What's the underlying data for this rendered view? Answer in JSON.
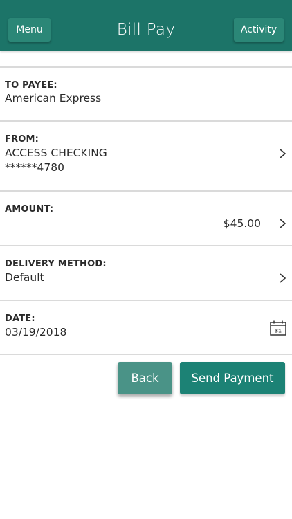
{
  "header": {
    "menu_label": "Menu",
    "title": "Bill Pay",
    "activity_label": "Activity"
  },
  "form": {
    "payee": {
      "label": "TO PAYEE:",
      "value": "American Express"
    },
    "from": {
      "label": "FROM:",
      "account_name": "ACCESS CHECKING",
      "account_number": "******4780"
    },
    "amount": {
      "label": "AMOUNT:",
      "value": "$45.00"
    },
    "delivery": {
      "label": "DELIVERY METHOD:",
      "value": "Default"
    },
    "date": {
      "label": "DATE:",
      "value": "03/19/2018",
      "calendar_day": "31"
    }
  },
  "actions": {
    "back_label": "Back",
    "send_label": "Send Payment"
  },
  "icons": {
    "chevron": "chevron-right-icon",
    "calendar": "calendar-icon"
  },
  "colors": {
    "header_bg": "#1c7468",
    "header_button": "#2b8777",
    "primary_button": "#1c8275",
    "back_button": "#4a9387",
    "divider": "#dadada"
  }
}
